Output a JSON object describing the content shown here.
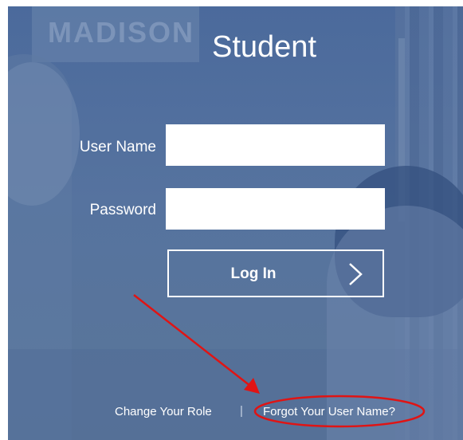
{
  "page": {
    "title": "Student",
    "poster_text": "MADISON"
  },
  "form": {
    "username_label": "User Name",
    "username_value": "",
    "password_label": "Password",
    "password_value": "",
    "login_label": "Log In",
    "login_icon": "chevron-right-icon"
  },
  "footer": {
    "change_role_label": "Change Your Role",
    "separator": "|",
    "forgot_username_label": "Forgot Your User Name?"
  },
  "annotations": {
    "arrow_color": "#e01414",
    "circle_color": "#e01414"
  },
  "colors": {
    "overlay_blue": "#4f6d9d",
    "text": "#ffffff"
  }
}
